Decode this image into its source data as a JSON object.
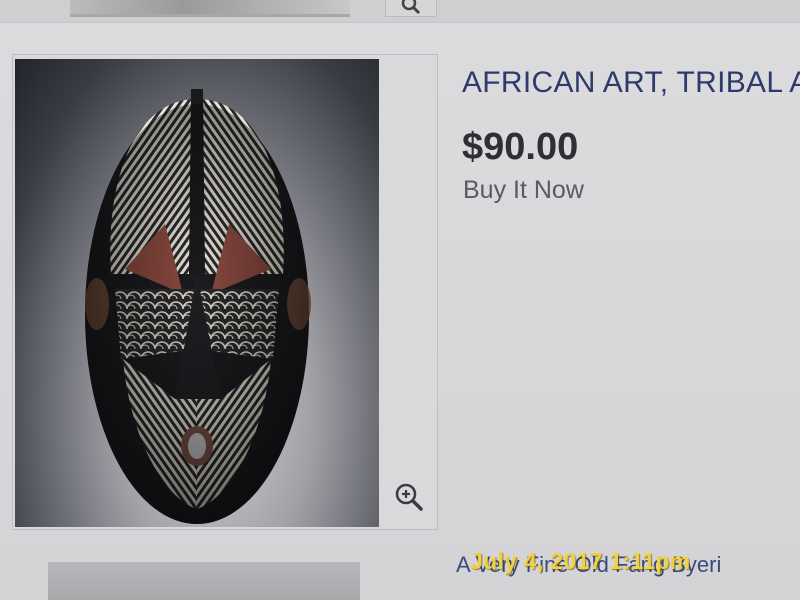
{
  "listing": {
    "title": "AFRICAN ART, TRIBAL A",
    "price": "$90.00",
    "format": "Buy It Now",
    "description_snippet": "A Very Fine Old Fang Byeri"
  },
  "photo_overlay": {
    "timestamp": "July 4, 2017 1:11pm",
    "timestamp_color": "#f2d23c"
  },
  "icons": {
    "zoom": "zoom-in-icon",
    "top_zoom": "magnifier-icon"
  },
  "colors": {
    "title": "#2e3a6a",
    "price": "#2e2e33",
    "format": "#5a5a62"
  }
}
